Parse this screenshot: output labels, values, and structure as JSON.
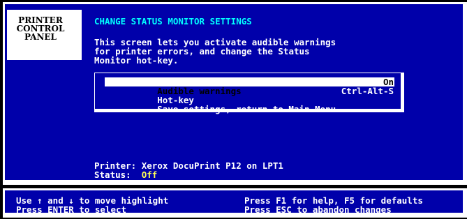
{
  "control_panel": {
    "line1": "PRINTER",
    "line2": "CONTROL",
    "line3": "PANEL"
  },
  "screen": {
    "title": "CHANGE STATUS MONITOR SETTINGS",
    "description": [
      "This screen lets you activate audible warnings",
      "for printer errors, and change the Status",
      "Monitor hot-key."
    ]
  },
  "menu": {
    "items": [
      {
        "label": "Audible warnings",
        "value": "On",
        "selected": true
      },
      {
        "label": "Hot-key",
        "value": "Ctrl-Alt-S",
        "selected": false
      },
      {
        "label": "Save settings, return to Main Menu",
        "value": "",
        "selected": false
      }
    ]
  },
  "printer": {
    "label": "Printer:",
    "name": "Xerox DocuPrint P12 on LPT1",
    "status_label": "Status:",
    "status_value": "Off"
  },
  "help": {
    "left_line1": "Use ↑ and ↓ to move highlight",
    "left_line2": "Press ENTER to select",
    "right_line1": "Press F1 for help, F5 for defaults",
    "right_line2": "Press ESC to abandon changes"
  },
  "colors": {
    "background": "#0000AA",
    "frame": "#FFFFFF",
    "title": "#00FFFF",
    "status_value": "#FFFF55",
    "highlight_bg": "#FFFFFF",
    "highlight_text": "#000000"
  }
}
